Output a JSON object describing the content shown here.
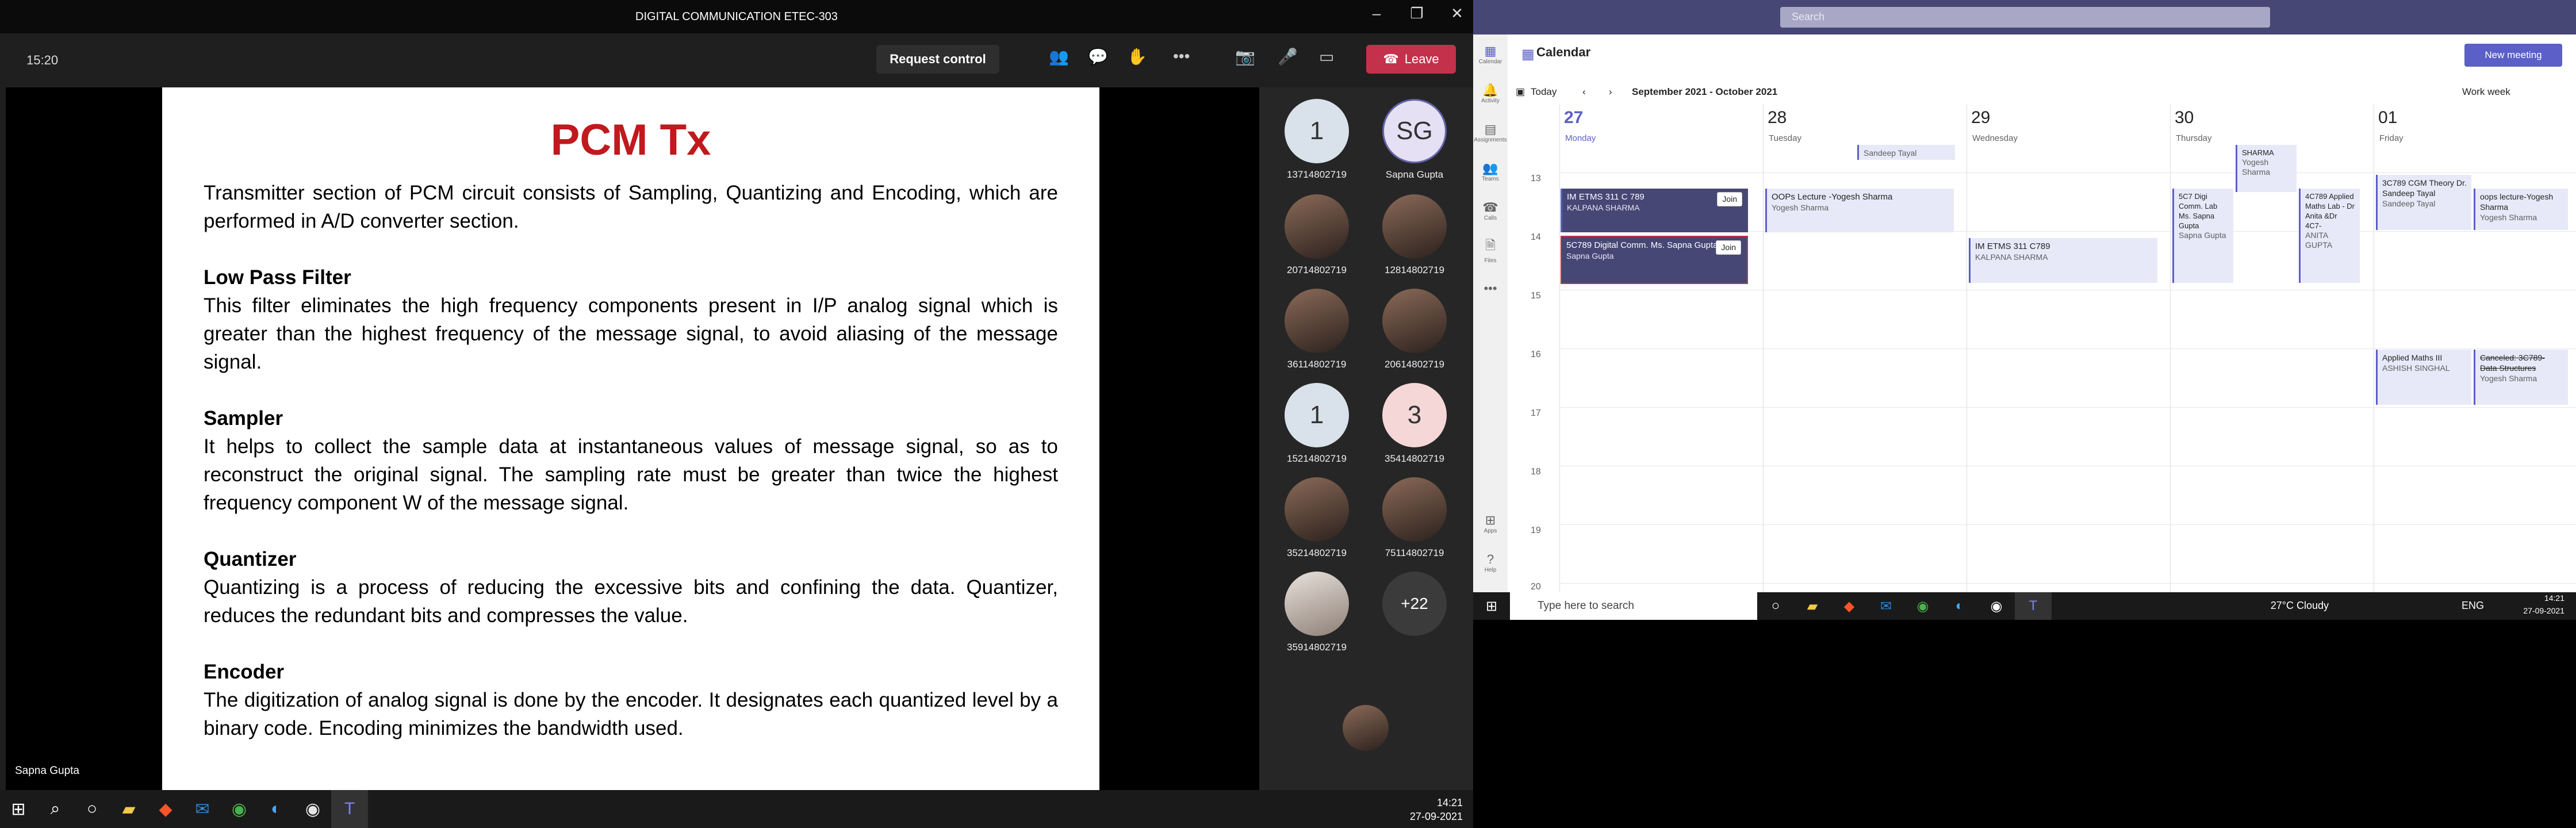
{
  "meeting": {
    "title": "DIGITAL COMMUNICATION ETEC-303",
    "timer": "15:20",
    "request_control": "Request control",
    "leave": "Leave",
    "speaker_name": "Sapna Gupta"
  },
  "slide": {
    "title": "PCM Tx",
    "intro": "Transmitter section of PCM circuit consists of Sampling, Quantizing and Encoding, which are performed in A/D converter section.",
    "sections": [
      {
        "heading": "Low Pass Filter",
        "body": "This filter eliminates the high frequency components present in I/P analog signal which is greater than the highest frequency of the message signal, to avoid aliasing of the message signal."
      },
      {
        "heading": "Sampler",
        "body": "It helps to collect the sample data at instantaneous values of message signal, so as to reconstruct the original signal. The sampling rate must be greater than twice the highest frequency component W of the message signal."
      },
      {
        "heading": "Quantizer",
        "body": "Quantizing is a process of reducing the excessive bits and confining the data. Quantizer, reduces the redundant bits and compresses the value."
      },
      {
        "heading": "Encoder",
        "body": "The digitization of analog signal is done by the encoder. It designates each quantized level by a binary code. Encoding minimizes the bandwidth used."
      }
    ]
  },
  "participants": [
    {
      "avatar": "1",
      "name": "13714802719"
    },
    {
      "avatar": "SG",
      "name": "Sapna Gupta"
    },
    {
      "avatar": "",
      "name": "20714802719"
    },
    {
      "avatar": "",
      "name": "12814802719"
    },
    {
      "avatar": "",
      "name": "36114802719"
    },
    {
      "avatar": "",
      "name": "20614802719"
    },
    {
      "avatar": "1",
      "name": "15214802719"
    },
    {
      "avatar": "3",
      "name": "35414802719"
    },
    {
      "avatar": "",
      "name": "35214802719"
    },
    {
      "avatar": "",
      "name": "75114802719"
    },
    {
      "avatar": "",
      "name": "35914802719"
    },
    {
      "avatar": "+22",
      "name": ""
    }
  ],
  "taskbar_left": {
    "time": "14:21",
    "date": "27-09-2021"
  },
  "calendar": {
    "search_placeholder": "Search",
    "title": "Calendar",
    "new_meeting": "New meeting",
    "today": "Today",
    "range": "September 2021 - October 2021",
    "view": "Work week",
    "rail": [
      "Calendar",
      "Activity",
      "Assignments",
      "Teams",
      "Calls",
      "Files",
      "Apps",
      "Help"
    ],
    "days": [
      {
        "num": "27",
        "name": "Monday"
      },
      {
        "num": "28",
        "name": "Tuesday"
      },
      {
        "num": "29",
        "name": "Wednesday"
      },
      {
        "num": "30",
        "name": "Thursday"
      },
      {
        "num": "01",
        "name": "Friday"
      }
    ],
    "hours": [
      "13",
      "14",
      "15",
      "16",
      "17",
      "18",
      "19",
      "20"
    ],
    "events": {
      "e1_title": "IM ETMS 311 C 789",
      "e1_sub": "KALPANA SHARMA",
      "join": "Join",
      "e2_title": "5C789 Digital Comm. Ms. Sapna Gupta",
      "e2_sub": "Sapna Gupta",
      "e3_title": "OOPs Lecture -Yogesh Sharma",
      "e3_sub": "Yogesh Sharma",
      "e4_title": "IM ETMS 311 C789",
      "e4_sub": "KALPANA SHARMA",
      "e5_title": "5C7 Digi Comm. Lab Ms. Sapna Gupta",
      "e5_sub": "Sapna Gupta",
      "e6_title": "SHARMA",
      "e6_sub": "Yogesh Sharma",
      "e7_title": "4C789 Applied Maths Lab - Dr Anita &Dr 4C7-",
      "e7_sub": "ANITA GUPTA",
      "e8_title": "3C789 CGM Theory Dr. Sandeep Tayal",
      "e8_sub": "Sandeep Tayal",
      "e9_title": "oops lecture-Yogesh Sharma",
      "e9_sub": "Yogesh Sharma",
      "e10_title": "Applied Maths III",
      "e10_sub": "ASHISH SINGHAL",
      "e11_title": "Canceled: 3C789- Data Structures",
      "e11_sub": "Yogesh Sharma",
      "e12_sub": "Sandeep Tayal"
    }
  },
  "win_taskbar": {
    "search": "Type here to search",
    "weather": "27°C Cloudy",
    "lang": "ENG",
    "time": "14:21",
    "date": "27-09-2021"
  }
}
